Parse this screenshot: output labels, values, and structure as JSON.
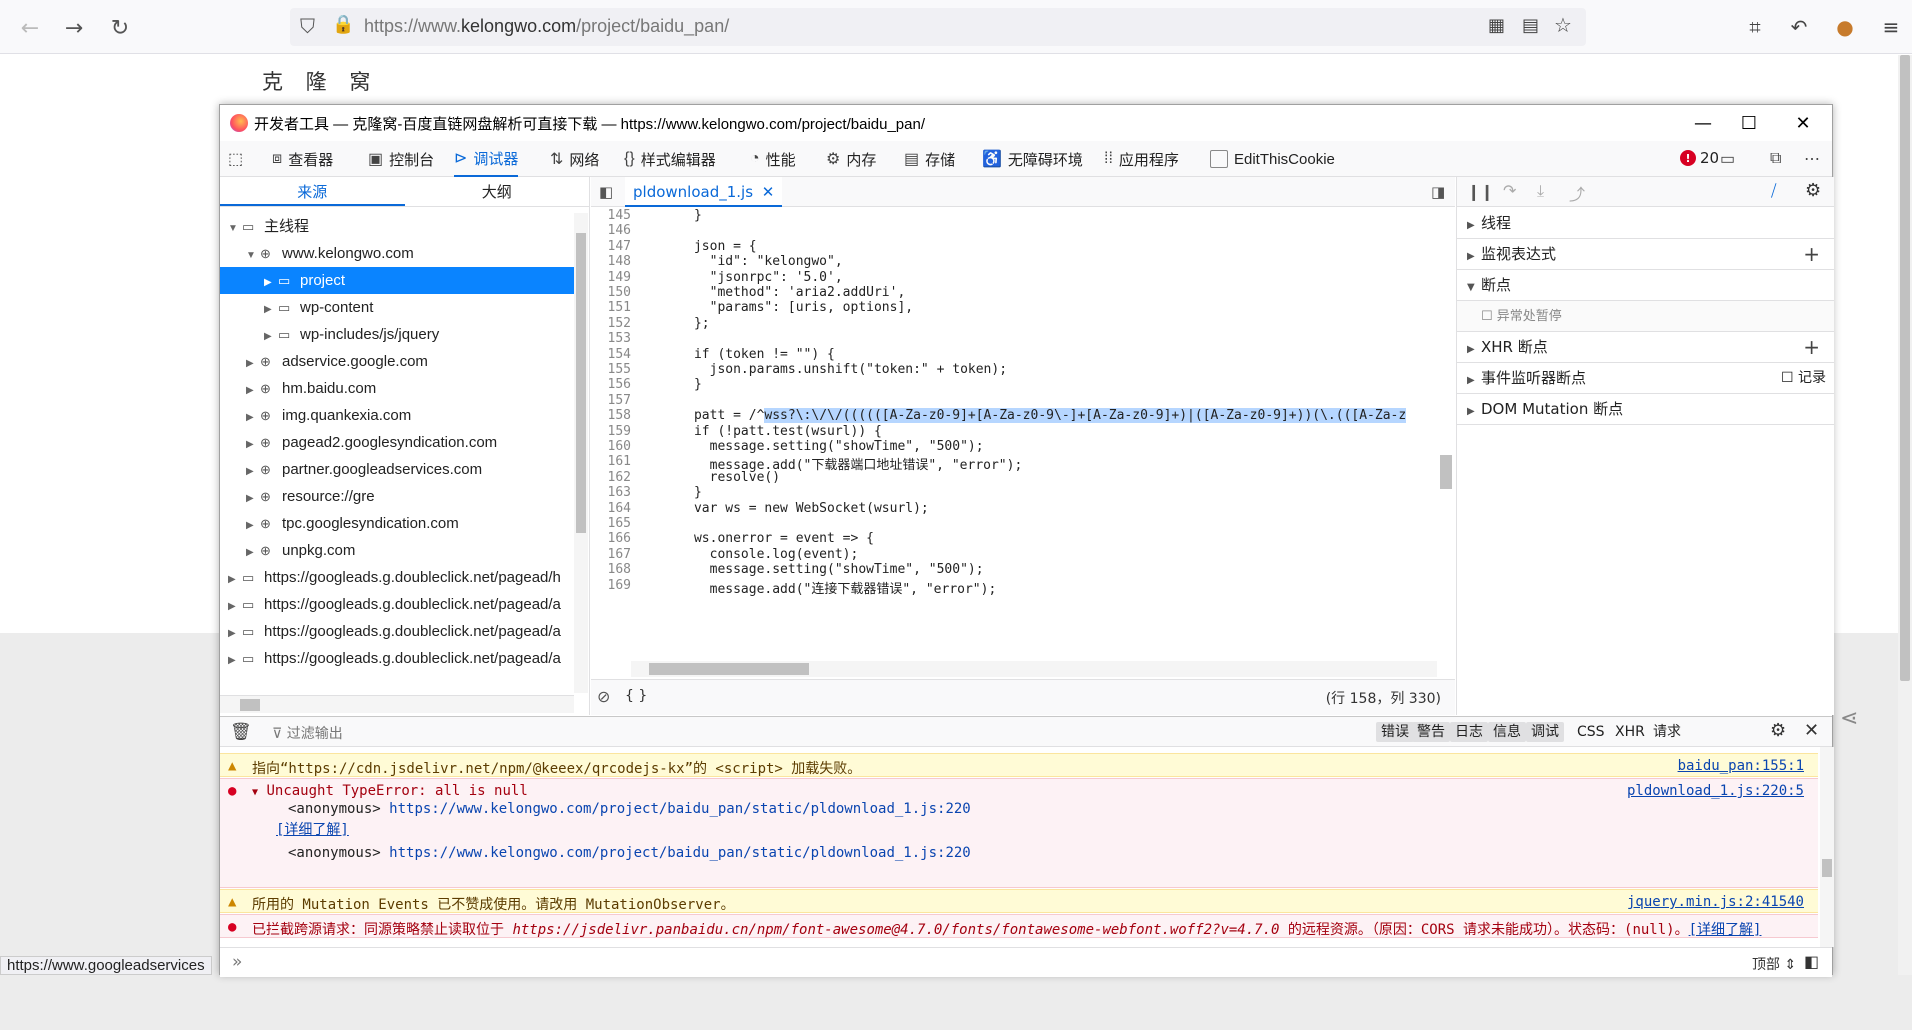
{
  "browser": {
    "url_prefix": "https://www.",
    "url_host": "kelongwo.com",
    "url_path": "/project/baidu_pan/",
    "status_url": "https://www.googleadservices"
  },
  "page": {
    "site_logo": "克 隆 窝"
  },
  "devtools": {
    "window_title": "开发者工具 — 克隆窝-百度直链网盘解析可直接下载 — https://www.kelongwo.com/project/baidu_pan/",
    "tools": [
      {
        "label": "查看器",
        "icon": "inspector-icon"
      },
      {
        "label": "控制台",
        "icon": "console-icon"
      },
      {
        "label": "调试器",
        "icon": "debugger-icon"
      },
      {
        "label": "网络",
        "icon": "network-icon"
      },
      {
        "label": "样式编辑器",
        "icon": "style-editor-icon"
      },
      {
        "label": "性能",
        "icon": "performance-icon"
      },
      {
        "label": "内存",
        "icon": "memory-icon"
      },
      {
        "label": "存储",
        "icon": "storage-icon"
      },
      {
        "label": "无障碍环境",
        "icon": "accessibility-icon"
      },
      {
        "label": "应用程序",
        "icon": "application-icon"
      },
      {
        "label": "EditThisCookie",
        "icon": "cookie-ext-icon"
      }
    ],
    "error_count": "20",
    "left": {
      "tab_sources": "来源",
      "tab_outline": "大纲",
      "tree": [
        "主线程",
        "www.kelongwo.com",
        "project",
        "wp-content",
        "wp-includes/js/jquery",
        "adservice.google.com",
        "hm.baidu.com",
        "img.quankexia.com",
        "pagead2.googlesyndication.com",
        "partner.googleadservices.com",
        "resource://gre",
        "tpc.googlesyndication.com",
        "unpkg.com",
        "https://googleads.g.doubleclick.net/pagead/h",
        "https://googleads.g.doubleclick.net/pagead/a",
        "https://googleads.g.doubleclick.net/pagead/a",
        "https://googleads.g.doubleclick.net/pagead/a"
      ]
    },
    "editor": {
      "file_tab": "pldownload_1.js",
      "position": "(行 158，列 330)",
      "pretty_print": "{ }",
      "line_numbers": [
        "145",
        "146",
        "147",
        "148",
        "149",
        "150",
        "151",
        "152",
        "153",
        "154",
        "155",
        "156",
        "157",
        "158",
        "159",
        "160",
        "161",
        "162",
        "163",
        "164",
        "165",
        "166",
        "167",
        "168",
        "169"
      ],
      "lines": [
        "      }",
        "",
        "      json = {",
        "        \"id\": \"kelongwo\",",
        "        \"jsonrpc\": '5.0',",
        "        \"method\": 'aria2.addUri',",
        "        \"params\": [uris, options],",
        "      };",
        "",
        "      if (token != \"\") {",
        "        json.params.unshift(\"token:\" + token);",
        "      }",
        "",
        "      patt = /^",
        "      if (!patt.test(wsurl)) {",
        "        message.setting(\"showTime\", \"500\");",
        "        message.add(\"下载器端口地址错误\", \"error\");",
        "        resolve()",
        "      }",
        "      var ws = new WebSocket(wsurl);",
        "",
        "      ws.onerror = event => {",
        "        console.log(event);",
        "        message.setting(\"showTime\", \"500\");",
        "        message.add(\"连接下载器错误\", \"error\");"
      ],
      "highlight": "wss?\\:\\/\\/((((([A-Za-z0-9]+[A-Za-z0-9\\-]+[A-Za-z0-9]+)|([A-Za-z0-9]+))(\\.(([A-Za-z"
    },
    "right": {
      "sections": [
        {
          "label": "线程",
          "expanded": false,
          "plus": false
        },
        {
          "label": "监视表达式",
          "expanded": false,
          "plus": true
        },
        {
          "label": "断点",
          "expanded": true,
          "plus": false
        },
        {
          "label": "XHR 断点",
          "expanded": false,
          "plus": true
        },
        {
          "label": "事件监听器断点",
          "expanded": false,
          "plus": false
        },
        {
          "label": "DOM Mutation 断点",
          "expanded": false,
          "plus": false
        }
      ],
      "pause_on_exceptions": "异常处暂停",
      "log_label": "记录"
    },
    "console": {
      "filter_placeholder": "过滤输出",
      "filters": [
        {
          "label": "错误",
          "on": true
        },
        {
          "label": "警告",
          "on": true
        },
        {
          "label": "日志",
          "on": true
        },
        {
          "label": "信息",
          "on": true
        },
        {
          "label": "调试",
          "on": true
        },
        {
          "label": "CSS",
          "on": false
        },
        {
          "label": "XHR",
          "on": false
        },
        {
          "label": "请求",
          "on": false
        }
      ],
      "messages": [
        {
          "kind": "warn",
          "text": "指向“https://cdn.jsdelivr.net/npm/@keeex/qrcodejs-kx”的 <script> 加载失败。",
          "source": "baidu_pan:155:1"
        },
        {
          "kind": "err",
          "text": "Uncaught TypeError: all is null",
          "source": "pldownload_1.js:220:5",
          "stack1_label": "<anonymous>",
          "stack1_url": "https://www.kelongwo.com/project/baidu_pan/static/pldownload_1.js:220",
          "learn_more": "[详细了解]",
          "stack2_label": "<anonymous>",
          "stack2_url": "https://www.kelongwo.com/project/baidu_pan/static/pldownload_1.js:220"
        },
        {
          "kind": "warn",
          "text": "所用的 Mutation Events 已不赞成使用。请改用 MutationObserver。",
          "source": "jquery.min.js:2:41540"
        },
        {
          "kind": "err",
          "text_pre": "已拦截跨源请求：同源策略禁止读取位于 ",
          "text_url": "https://jsdelivr.panbaidu.cn/npm/font-awesome@4.7.0/fonts/fontawesome-webfont.woff2?v=4.7.0",
          "text_post": " 的远程资源。（原因：CORS 请求未能成功）。状态码：(null)。",
          "learn_more": "[详细了解]"
        }
      ],
      "prompt": "»",
      "scroll_top": "顶部"
    }
  },
  "colors": {
    "accent": "#0a84ff",
    "error": "#d70022",
    "warn_bg": "#fffbd6",
    "err_bg": "#fdf2f5"
  }
}
